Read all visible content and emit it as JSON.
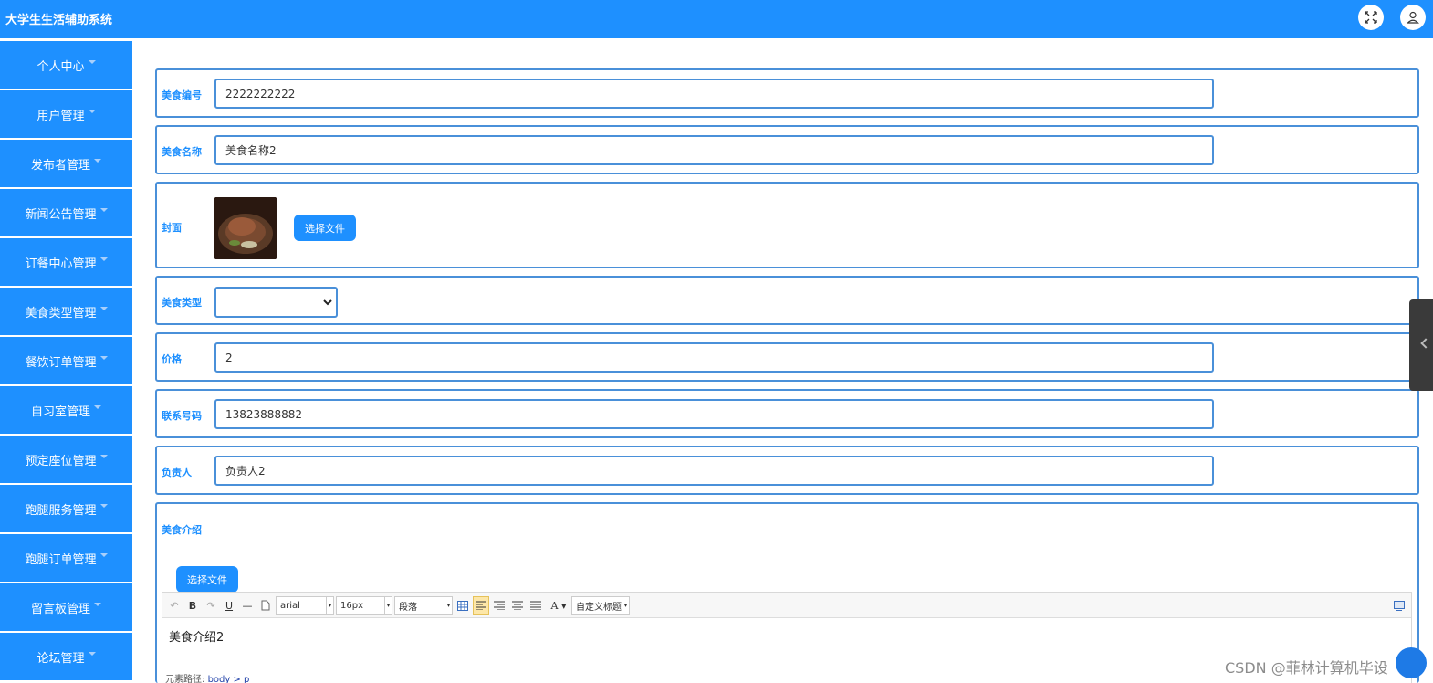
{
  "header": {
    "title": "大学生生活辅助系统",
    "icons": [
      "fullscreen-icon",
      "user-icon"
    ]
  },
  "sidebar": {
    "items": [
      {
        "label": "个人中心"
      },
      {
        "label": "用户管理"
      },
      {
        "label": "发布者管理"
      },
      {
        "label": "新闻公告管理"
      },
      {
        "label": "订餐中心管理"
      },
      {
        "label": "美食类型管理"
      },
      {
        "label": "餐饮订单管理"
      },
      {
        "label": "自习室管理"
      },
      {
        "label": "预定座位管理"
      },
      {
        "label": "跑腿服务管理"
      },
      {
        "label": "跑腿订单管理"
      },
      {
        "label": "留言板管理"
      },
      {
        "label": "论坛管理"
      }
    ]
  },
  "form": {
    "code": {
      "label": "美食编号",
      "value": "2222222222"
    },
    "name": {
      "label": "美食名称",
      "value": "美食名称2"
    },
    "cover": {
      "label": "封面",
      "button": "选择文件"
    },
    "type": {
      "label": "美食类型",
      "value": ""
    },
    "price": {
      "label": "价格",
      "value": "2"
    },
    "phone": {
      "label": "联系号码",
      "value": "13823888882"
    },
    "owner": {
      "label": "负责人",
      "value": "负责人2"
    },
    "intro": {
      "label": "美食介绍",
      "button": "选择文件",
      "toolbar": {
        "font": "arial",
        "size": "16px",
        "paragraph": "段落",
        "custom_title": "自定义标题"
      },
      "content": "美食介绍2",
      "path_label": "元素路径:",
      "path_value": "body > p"
    }
  },
  "watermark": "CSDN @菲林计算机毕设",
  "colors": {
    "primary": "#1e90ff",
    "border": "#4a90d9",
    "label": "#1e90ff"
  }
}
